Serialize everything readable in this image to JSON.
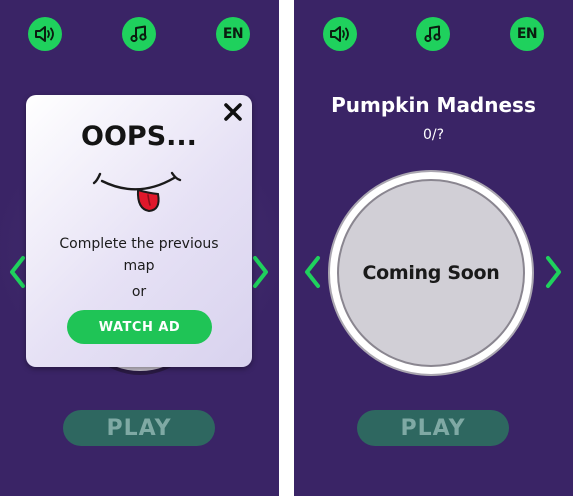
{
  "colors": {
    "background": "#3a2466",
    "accent_green": "#1fd15d",
    "play_button": "#2e6760",
    "play_text": "#7fa9a4"
  },
  "icons": {
    "sound": "speaker-icon",
    "music": "music-note-icon",
    "close": "close-icon",
    "arrow_left": "chevron-left-icon",
    "arrow_right": "chevron-right-icon",
    "face": "tongue-out-face-icon"
  },
  "left_screen": {
    "top_bar": {
      "language": "EN"
    },
    "popup": {
      "title": "OOPS...",
      "message_line1": "Complete the previous",
      "message_line2": "map",
      "or_text": "or",
      "watch_ad_label": "WATCH AD"
    },
    "play_label": "PLAY"
  },
  "right_screen": {
    "top_bar": {
      "language": "EN"
    },
    "map_title": "Pumpkin Madness",
    "progress": "0/?",
    "map_status": "Coming Soon",
    "play_label": "PLAY"
  }
}
